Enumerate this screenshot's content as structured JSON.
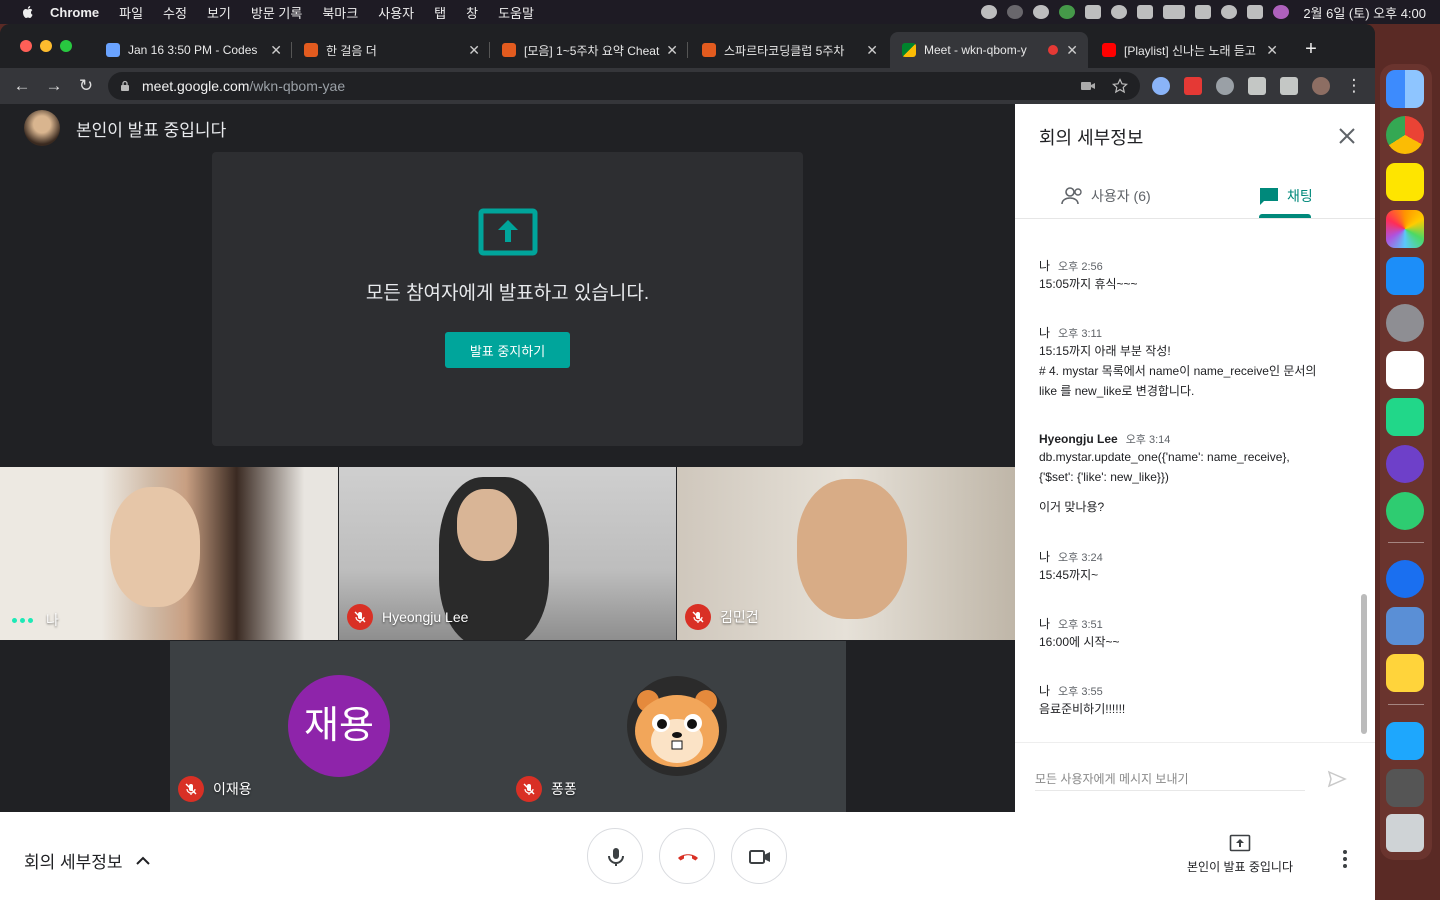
{
  "menubar": {
    "app": "Chrome",
    "menus": [
      "파일",
      "수정",
      "보기",
      "방문 기록",
      "북마크",
      "사용자",
      "탭",
      "창",
      "도움말"
    ],
    "clock": "2월 6일 (토) 오후 4:00"
  },
  "tabs": [
    {
      "title": "Jan 16 3:50 PM - Codes"
    },
    {
      "title": "한 걸음 더"
    },
    {
      "title": "[모음] 1~5주차 요약 Cheat"
    },
    {
      "title": "스파르타코딩클럽 5주차"
    },
    {
      "title": "Meet - wkn-qbom-y"
    },
    {
      "title": "[Playlist] 신나는 노래 듣고"
    }
  ],
  "newtab": "+",
  "url": {
    "host": "meet.google.com",
    "path": "/wkn-qbom-yae"
  },
  "meet": {
    "presenting_banner": "본인이 발표 중입니다",
    "presenting_message": "모든 참여자에게 발표하고 있습니다.",
    "stop_button": "발표 중지하기",
    "participants": [
      {
        "name": "나"
      },
      {
        "name": "Hyeongju Lee"
      },
      {
        "name": "김민건"
      },
      {
        "name": "이재용",
        "avatar_text": "재용"
      },
      {
        "name": "퐁퐁"
      }
    ]
  },
  "sidepanel": {
    "title": "회의 세부정보",
    "tab_people": "사용자 (6)",
    "tab_chat": "채팅",
    "messages": [
      {
        "sender": "나",
        "time": "오후 2:56",
        "lines": [
          "15:05까지 휴식~~~"
        ]
      },
      {
        "sender": "나",
        "time": "오후 3:11",
        "lines": [
          "15:15까지 아래 부분 작성!",
          "# 4. mystar 목록에서 name이 name_receive인 문서의",
          "like 를 new_like로 변경합니다."
        ]
      },
      {
        "sender": "Hyeongju Lee",
        "time": "오후 3:14",
        "lines": [
          "db.mystar.update_one({'name': name_receive},",
          "{'$set': {'like': new_like}})"
        ],
        "lines2": [
          "이거 맞나용?"
        ]
      },
      {
        "sender": "나",
        "time": "오후 3:24",
        "lines": [
          "15:45까지~"
        ]
      },
      {
        "sender": "나",
        "time": "오후 3:51",
        "lines": [
          "16:00에 시작~~"
        ]
      },
      {
        "sender": "나",
        "time": "오후 3:55",
        "lines": [
          "음료준비하기!!!!!!"
        ]
      }
    ],
    "input_placeholder": "모든 사용자에게 메시지 보내기"
  },
  "bottombar": {
    "details_label": "회의 세부정보",
    "presenting_label": "본인이 발표 중입니다"
  },
  "colors": {
    "accent": "#00897b",
    "meet_bg": "#202124",
    "danger": "#d93025",
    "avatar_purple": "#8e24aa"
  }
}
